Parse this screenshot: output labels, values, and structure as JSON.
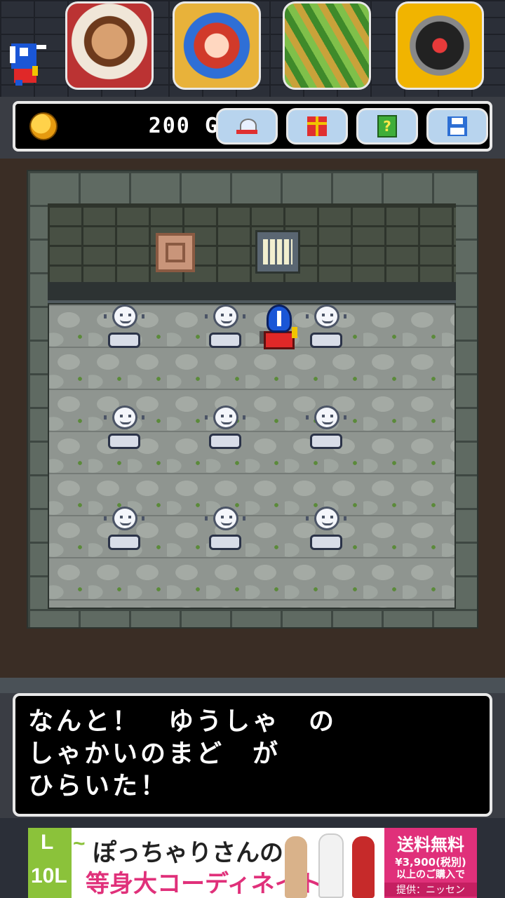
{
  "hud": {
    "gold_amount": "200",
    "gold_unit": "G",
    "buttons": [
      "record-icon",
      "gift-icon",
      "hint-book-icon",
      "save-icon"
    ],
    "hint_glyph": "?"
  },
  "promo_apps": [
    "warrior-portrait",
    "anime-heroine",
    "farm-field",
    "masked-rider"
  ],
  "room": {
    "statues": 9,
    "colors": {
      "floor": "#8f9590",
      "wall": "#485044",
      "hero_helm": "#1a56d6",
      "hero_body": "#e02828"
    }
  },
  "dialog": {
    "line1": "なんと！　ゆうしゃ　の",
    "line2": "しゃかいのまど　が",
    "line3": "ひらいた！"
  },
  "ad": {
    "size_from": "L",
    "tilde": "~",
    "size_to": "10L",
    "title": "ぽっちゃりさんの",
    "subtitle": "等身大コーディネイト",
    "offer_title": "送料無料",
    "offer_price": "¥3,900(税別)",
    "offer_cond": "以上のご購入で",
    "offer_by": "提供：ニッセン"
  }
}
